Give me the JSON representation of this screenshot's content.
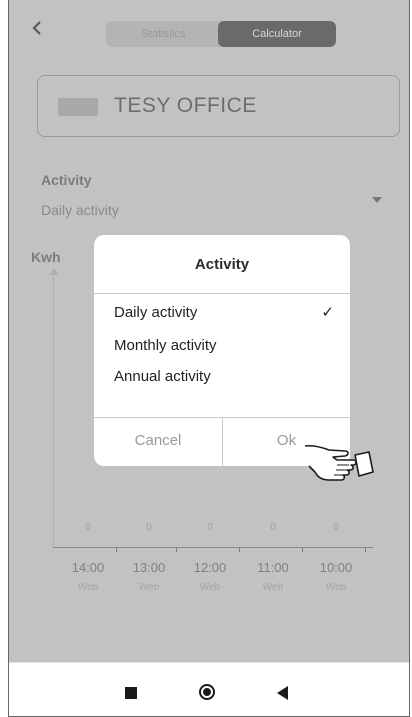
{
  "header": {
    "back_icon": "chevron-left-icon",
    "tabs": [
      {
        "label": "Statistics",
        "selected": false
      },
      {
        "label": "Calculator",
        "selected": true
      }
    ]
  },
  "device": {
    "name": "TESY OFFICE",
    "icon": "device-thumbnail-icon"
  },
  "activity": {
    "title": "Activity",
    "value": "Daily activity"
  },
  "chart": {
    "unit": "Kwh",
    "columns": [
      {
        "value": "0",
        "time": "14:00",
        "day": "Web"
      },
      {
        "value": "0",
        "time": "13:00",
        "day": "Web"
      },
      {
        "value": "0",
        "time": "12:00",
        "day": "Web"
      },
      {
        "value": "0",
        "time": "11:00",
        "day": "Web"
      },
      {
        "value": "0",
        "time": "10:00",
        "day": "Web"
      }
    ]
  },
  "dialog": {
    "title": "Activity",
    "options": [
      {
        "label": "Daily activity",
        "selected": true
      },
      {
        "label": "Monthly activity",
        "selected": false
      },
      {
        "label": "Annual activity",
        "selected": false
      }
    ],
    "checkmark": "✓",
    "cancel_label": "Cancel",
    "ok_label": "Ok"
  },
  "navbar": {
    "icons": [
      "recents-square-icon",
      "home-circle-icon",
      "back-triangle-icon"
    ]
  },
  "colors": {
    "overlay": "#c2c2c2",
    "dialog_bg": "#ffffff",
    "selected_tab": "#6a6a6a"
  }
}
